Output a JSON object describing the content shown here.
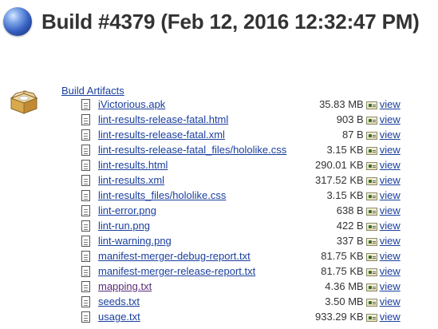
{
  "page": {
    "title": "Build #4379 (Feb 12, 2016 12:32:47 PM)"
  },
  "artifacts": {
    "heading": "Build Artifacts",
    "view_label": "view",
    "files": [
      {
        "name": "iVictorious.apk",
        "size": "35.83 MB",
        "visited": false
      },
      {
        "name": "lint-results-release-fatal.html",
        "size": "903 B",
        "visited": false
      },
      {
        "name": "lint-results-release-fatal.xml",
        "size": "87 B",
        "visited": false
      },
      {
        "name": "lint-results-release-fatal_files/hololike.css",
        "size": "3.15 KB",
        "visited": false
      },
      {
        "name": "lint-results.html",
        "size": "290.01 KB",
        "visited": false
      },
      {
        "name": "lint-results.xml",
        "size": "317.52 KB",
        "visited": false
      },
      {
        "name": "lint-results_files/hololike.css",
        "size": "3.15 KB",
        "visited": false
      },
      {
        "name": "lint-error.png",
        "size": "638 B",
        "visited": false
      },
      {
        "name": "lint-run.png",
        "size": "422 B",
        "visited": false
      },
      {
        "name": "lint-warning.png",
        "size": "337 B",
        "visited": false
      },
      {
        "name": "manifest-merger-debug-report.txt",
        "size": "81.75 KB",
        "visited": false
      },
      {
        "name": "manifest-merger-release-report.txt",
        "size": "81.75 KB",
        "visited": false
      },
      {
        "name": "mapping.txt",
        "size": "4.36 MB",
        "visited": true
      },
      {
        "name": "seeds.txt",
        "size": "3.50 MB",
        "visited": false
      },
      {
        "name": "usage.txt",
        "size": "933.29 KB",
        "visited": false
      }
    ]
  },
  "colors": {
    "link": "#1a3f9e",
    "visited_link": "#5a2a7a",
    "text": "#333333"
  }
}
